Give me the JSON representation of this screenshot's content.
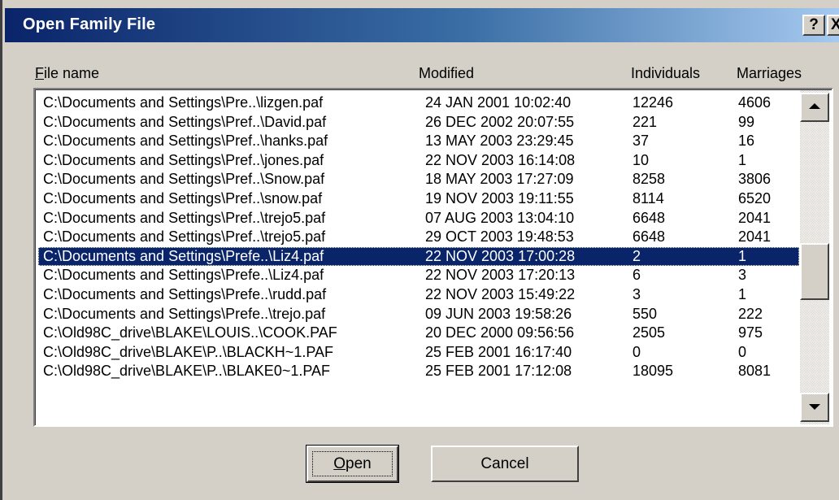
{
  "window": {
    "title": "Open Family File",
    "help_label": "?",
    "close_label": "X"
  },
  "columns": {
    "file_name_mnemonic": "F",
    "file_name_rest": "ile name",
    "modified": "Modified",
    "individuals": "Individuals",
    "marriages": "Marriages"
  },
  "files": [
    {
      "path": "C:\\Documents and Settings\\Pre..\\lizgen.paf",
      "modified": "24 JAN 2001 10:02:40",
      "individuals": "12246",
      "marriages": "4606"
    },
    {
      "path": "C:\\Documents and Settings\\Pref..\\David.paf",
      "modified": "26 DEC 2002 20:07:55",
      "individuals": "221",
      "marriages": "99"
    },
    {
      "path": "C:\\Documents and Settings\\Pref..\\hanks.paf",
      "modified": "13 MAY 2003 23:29:45",
      "individuals": "37",
      "marriages": "16"
    },
    {
      "path": "C:\\Documents and Settings\\Pref..\\jones.paf",
      "modified": "22 NOV 2003 16:14:08",
      "individuals": "10",
      "marriages": "1"
    },
    {
      "path": "C:\\Documents and Settings\\Pref..\\Snow.paf",
      "modified": "18 MAY 2003 17:27:09",
      "individuals": "8258",
      "marriages": "3806"
    },
    {
      "path": "C:\\Documents and Settings\\Pref..\\snow.paf",
      "modified": "19 NOV 2003 19:11:55",
      "individuals": "8114",
      "marriages": "6520"
    },
    {
      "path": "C:\\Documents and Settings\\Pref..\\trejo5.paf",
      "modified": "07 AUG 2003 13:04:10",
      "individuals": "6648",
      "marriages": "2041"
    },
    {
      "path": "C:\\Documents and Settings\\Pref..\\trejo5.paf",
      "modified": "29 OCT 2003 19:48:53",
      "individuals": "6648",
      "marriages": "2041"
    },
    {
      "path": "C:\\Documents and Settings\\Prefe..\\Liz4.paf",
      "modified": "22 NOV 2003 17:00:28",
      "individuals": "2",
      "marriages": "1",
      "selected": true
    },
    {
      "path": "C:\\Documents and Settings\\Prefe..\\Liz4.paf",
      "modified": "22 NOV 2003 17:20:13",
      "individuals": "6",
      "marriages": "3"
    },
    {
      "path": "C:\\Documents and Settings\\Prefe..\\rudd.paf",
      "modified": "22 NOV 2003 15:49:22",
      "individuals": "3",
      "marriages": "1"
    },
    {
      "path": "C:\\Documents and Settings\\Prefe..\\trejo.paf",
      "modified": "09 JUN 2003 19:58:26",
      "individuals": "550",
      "marriages": "222"
    },
    {
      "path": "C:\\Old98C_drive\\BLAKE\\LOUIS..\\COOK.PAF",
      "modified": "20 DEC 2000 09:56:56",
      "individuals": "2505",
      "marriages": "975"
    },
    {
      "path": "C:\\Old98C_drive\\BLAKE\\P..\\BLACKH~1.PAF",
      "modified": "25 FEB 2001 16:17:40",
      "individuals": "0",
      "marriages": "0"
    },
    {
      "path": "C:\\Old98C_drive\\BLAKE\\P..\\BLAKE0~1.PAF",
      "modified": "25 FEB 2001 17:12:08",
      "individuals": "18095",
      "marriages": "8081"
    }
  ],
  "buttons": {
    "open_mnemonic": "O",
    "open_rest": "pen",
    "cancel": "Cancel"
  },
  "colors": {
    "title_start": "#0a246a",
    "title_end": "#a6caf0",
    "selection": "#0a246a",
    "face": "#d4d0c8"
  },
  "icons": {
    "scroll_up": "triangle-up-icon",
    "scroll_down": "triangle-down-icon"
  }
}
